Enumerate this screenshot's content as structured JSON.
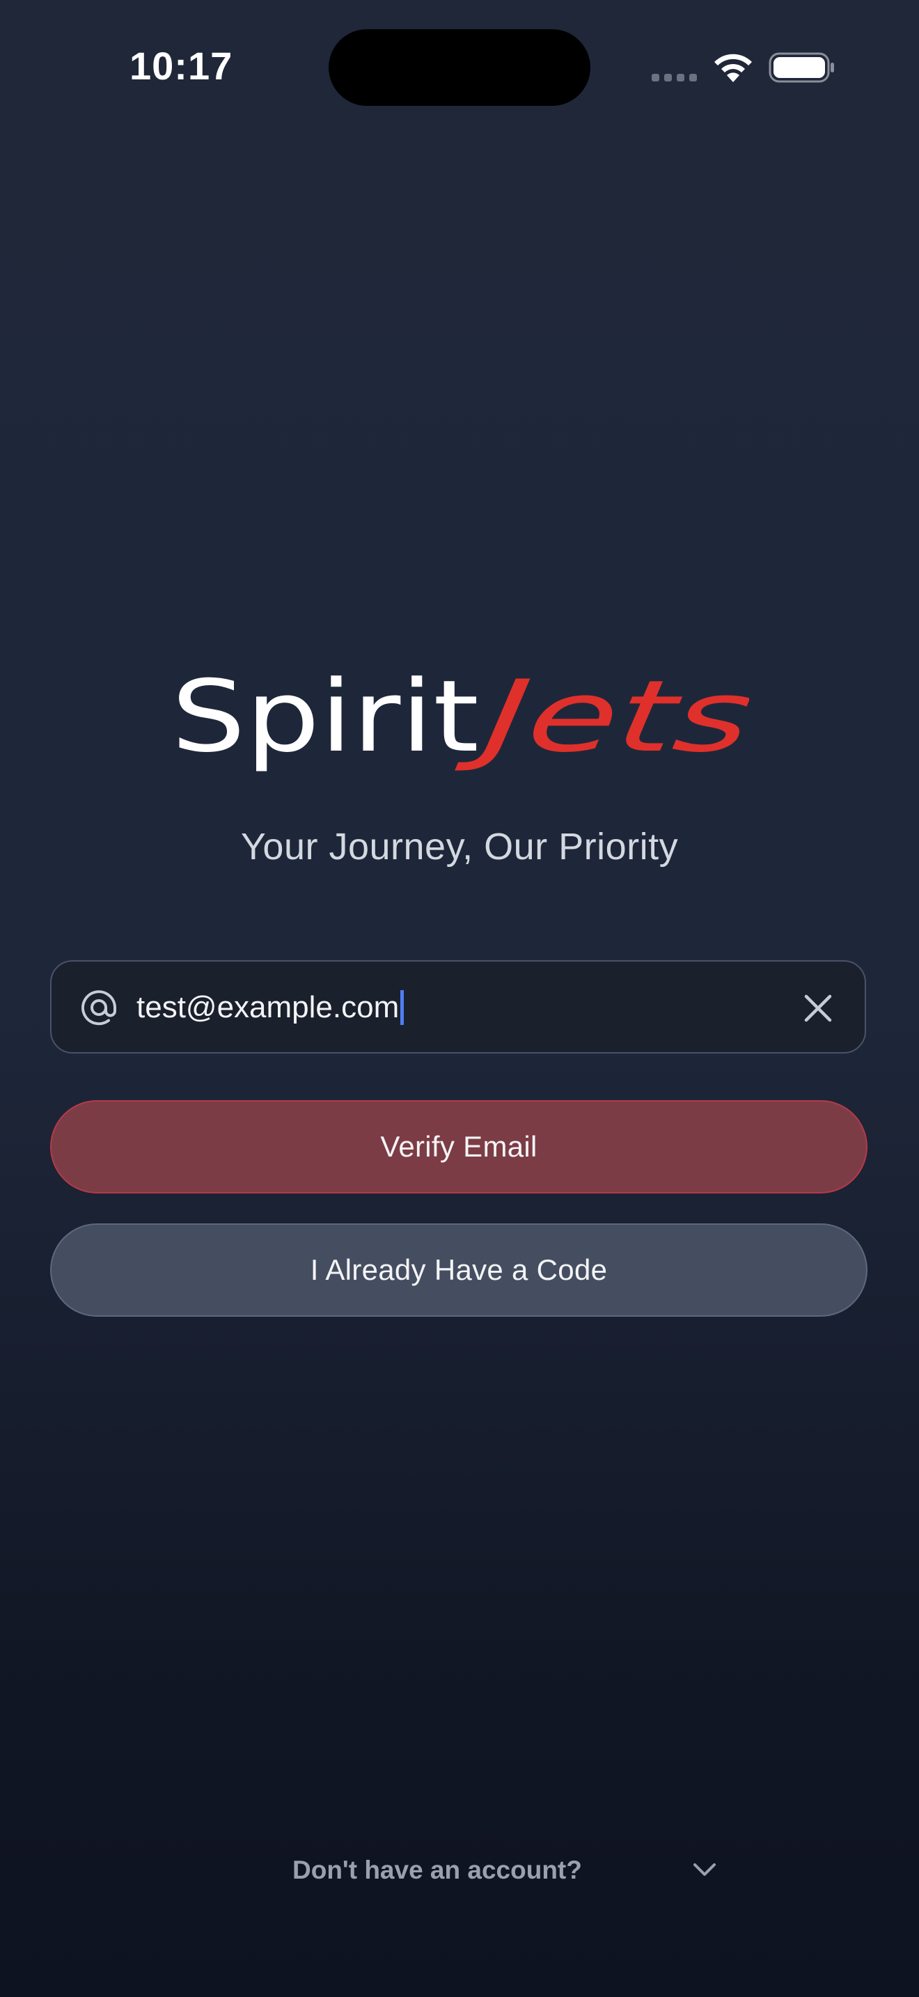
{
  "status_bar": {
    "time": "10:17"
  },
  "brand": {
    "logo_word_1": "Spirit",
    "logo_word_2": "Jets",
    "logo_color_1": "#ffffff",
    "logo_color_2": "#e0302b"
  },
  "tagline": "Your Journey, Our Priority",
  "email_input": {
    "value": "test@example.com",
    "icon": "at-icon",
    "clear_icon": "close-icon"
  },
  "buttons": {
    "verify_label": "Verify Email",
    "code_label": "I Already Have a Code"
  },
  "footer": {
    "prompt": "Don't have an account?",
    "icon": "chevron-down-icon"
  },
  "colors": {
    "accent_red": "#e0302b",
    "verify_button": "#7c3c45",
    "secondary_button": "#454e61",
    "caret": "#4f7df5"
  }
}
